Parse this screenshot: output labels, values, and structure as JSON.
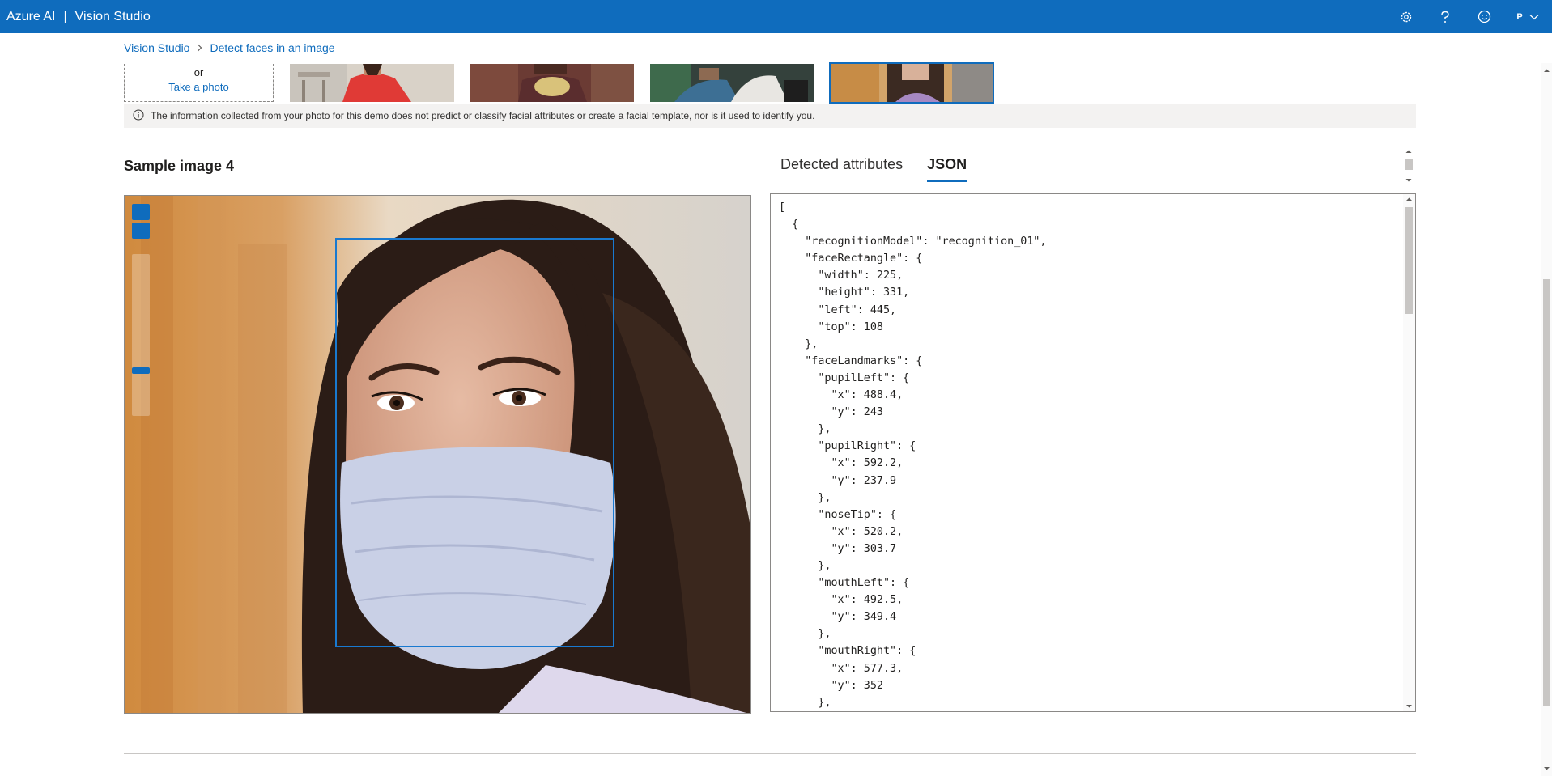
{
  "header": {
    "brand_primary": "Azure AI",
    "brand_separator": "|",
    "brand_secondary": "Vision Studio",
    "avatar_initial": "P",
    "icons": [
      "settings-icon",
      "help-icon",
      "feedback-icon"
    ]
  },
  "breadcrumb": {
    "items": [
      "Vision Studio",
      "Detect faces in an image"
    ]
  },
  "upload": {
    "or_label": "or",
    "take_photo": "Take a photo"
  },
  "samples": {
    "selected_index": 4
  },
  "info": {
    "text": "The information collected from your photo for this demo does not predict or classify facial attributes or create a facial template, nor is it used to identify you."
  },
  "image_panel": {
    "title": "Sample image 4"
  },
  "tabs": [
    "Detected attributes",
    "JSON"
  ],
  "active_tab": "JSON",
  "json_lines": [
    "[",
    "  {",
    "    \"recognitionModel\": \"recognition_01\",",
    "    \"faceRectangle\": {",
    "      \"width\": 225,",
    "      \"height\": 331,",
    "      \"left\": 445,",
    "      \"top\": 108",
    "    },",
    "    \"faceLandmarks\": {",
    "      \"pupilLeft\": {",
    "        \"x\": 488.4,",
    "        \"y\": 243",
    "      },",
    "      \"pupilRight\": {",
    "        \"x\": 592.2,",
    "        \"y\": 237.9",
    "      },",
    "      \"noseTip\": {",
    "        \"x\": 520.2,",
    "        \"y\": 303.7",
    "      },",
    "      \"mouthLeft\": {",
    "        \"x\": 492.5,",
    "        \"y\": 349.4",
    "      },",
    "      \"mouthRight\": {",
    "        \"x\": 577.3,",
    "        \"y\": 352",
    "      },"
  ],
  "colors": {
    "accent": "#0f6cbd",
    "face_box": "#1979d0"
  }
}
